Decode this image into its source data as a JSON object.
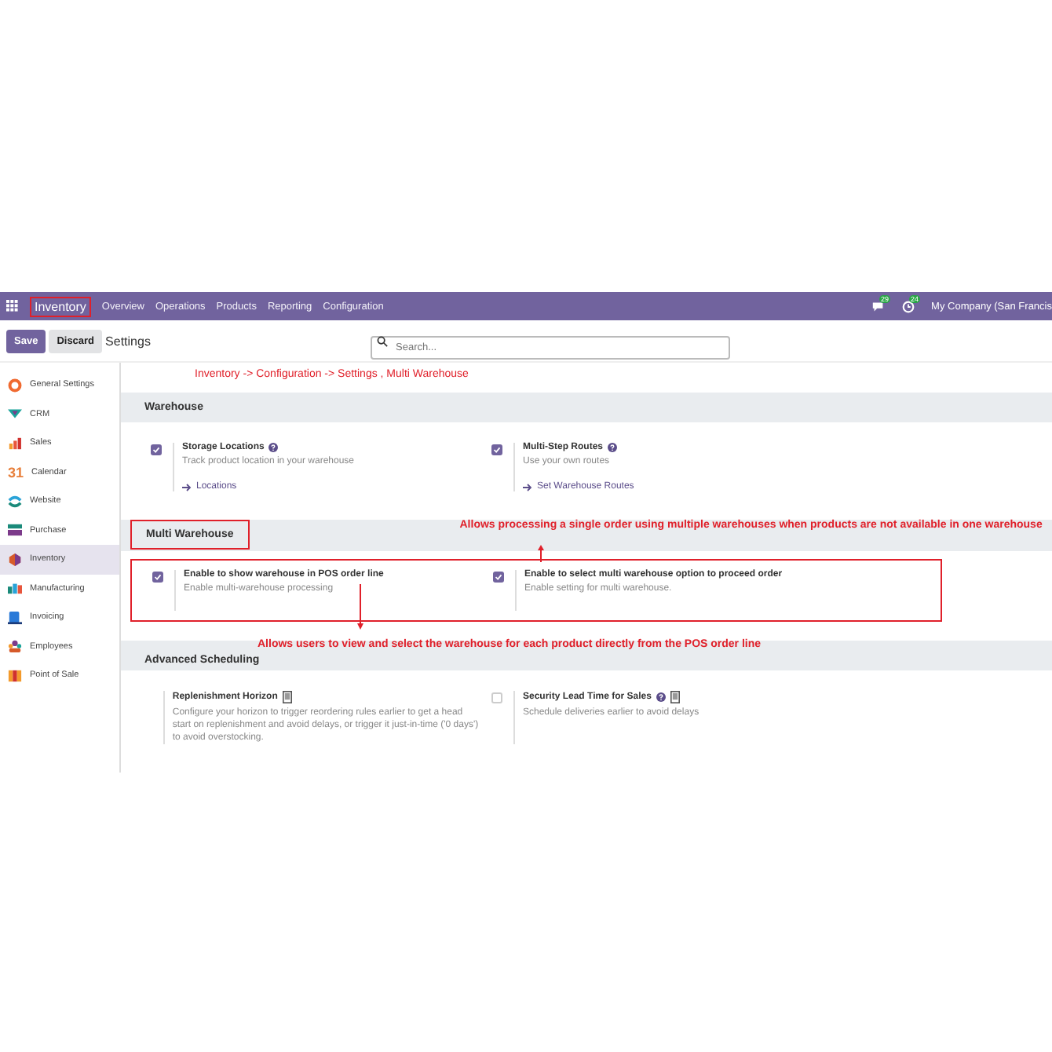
{
  "navbar": {
    "app": "Inventory",
    "menu": [
      "Overview",
      "Operations",
      "Products",
      "Reporting",
      "Configuration"
    ],
    "chat_count": "29",
    "activity_count": "24",
    "company": "My Company (San Francis"
  },
  "control_bar": {
    "save": "Save",
    "discard": "Discard",
    "title": "Settings",
    "search": {
      "placeholder": "Search..."
    }
  },
  "sidebar": {
    "items": [
      {
        "label": "General Settings",
        "selected": false
      },
      {
        "label": "CRM",
        "selected": false
      },
      {
        "label": "Sales",
        "selected": false
      },
      {
        "label": "Calendar",
        "selected": false,
        "icon_text": "31"
      },
      {
        "label": "Website",
        "selected": false
      },
      {
        "label": "Purchase",
        "selected": false
      },
      {
        "label": "Inventory",
        "selected": true
      },
      {
        "label": "Manufacturing",
        "selected": false
      },
      {
        "label": "Invoicing",
        "selected": false
      },
      {
        "label": "Employees",
        "selected": false
      },
      {
        "label": "Point of Sale",
        "selected": false
      }
    ]
  },
  "breadcrumb_note": "Inventory -> Configuration -> Settings , Multi Warehouse",
  "sections": [
    {
      "title": "Warehouse",
      "highlighted": false,
      "settings": [
        {
          "kind": "checkbox",
          "checked": true,
          "title": "Storage Locations",
          "help": true,
          "doc": false,
          "description": "Track product location in your warehouse",
          "link": "Locations"
        },
        {
          "kind": "checkbox",
          "checked": true,
          "title": "Multi-Step Routes",
          "help": true,
          "doc": false,
          "description": "Use your own routes",
          "link": "Set Warehouse Routes"
        }
      ]
    },
    {
      "title": "Multi Warehouse",
      "highlighted": true,
      "note": "Allows processing a single order using multiple warehouses when products are not available in one warehouse",
      "settings": [
        {
          "kind": "checkbox",
          "checked": true,
          "title": "Enable to show warehouse in POS order line",
          "help": false,
          "doc": false,
          "description": "Enable multi-warehouse processing"
        },
        {
          "kind": "checkbox",
          "checked": true,
          "title": "Enable to select multi warehouse option to proceed order",
          "help": false,
          "doc": false,
          "description": "Enable setting for multi warehouse."
        }
      ]
    },
    {
      "title": "Advanced Scheduling",
      "highlighted": false,
      "note": "Allows users to view and select the warehouse for each product directly from the POS order line",
      "settings": [
        {
          "kind": "plain",
          "title": "Replenishment Horizon",
          "help": false,
          "doc": true,
          "description": "Configure your horizon to trigger reordering rules earlier to get a head start on replenishment and avoid delays, or trigger it just-in-time ('0 days') to avoid overstocking."
        },
        {
          "kind": "checkbox",
          "checked": false,
          "title": "Security Lead Time for Sales",
          "help": true,
          "doc": true,
          "description": "Schedule deliveries earlier to avoid delays"
        }
      ]
    }
  ]
}
